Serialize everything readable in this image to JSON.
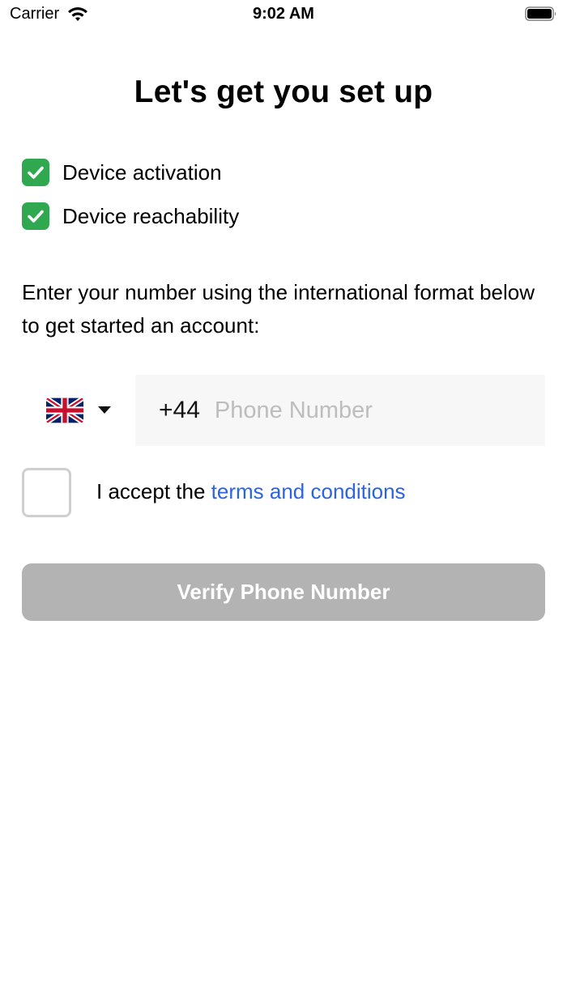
{
  "status_bar": {
    "carrier": "Carrier",
    "time": "9:02 AM"
  },
  "title": "Let's get you set up",
  "checklist": [
    {
      "label": "Device activation",
      "checked": true
    },
    {
      "label": "Device reachability",
      "checked": true
    }
  ],
  "instructions": "Enter your number using the international format below to get started an account:",
  "phone": {
    "country_flag": "uk-flag-icon",
    "dial_code": "+44",
    "value": "",
    "placeholder": "Phone Number"
  },
  "terms": {
    "prefix": "I accept the ",
    "link_text": "terms and conditions",
    "checked": false
  },
  "verify_button": {
    "label": "Verify Phone Number",
    "enabled": false
  },
  "colors": {
    "check_green": "#2fa84f",
    "link_blue": "#2b64e3",
    "button_disabled": "#b3b3b3",
    "field_bg": "#f6f7f6"
  }
}
